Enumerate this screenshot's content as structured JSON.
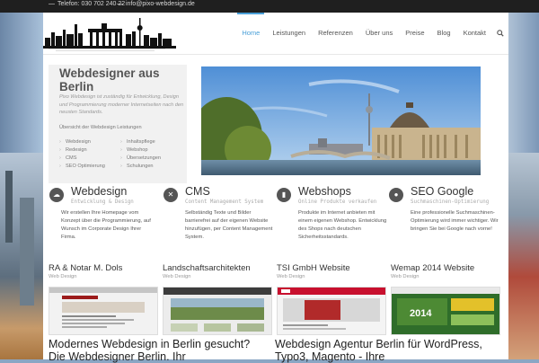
{
  "topbar": {
    "phone": "Telefon: 030 702 240 22",
    "email": "info@pixo-webdesign.de"
  },
  "nav": {
    "items": [
      "Home",
      "Leistungen",
      "Referenzen",
      "Über uns",
      "Preise",
      "Blog",
      "Kontakt"
    ],
    "active": "Home"
  },
  "intro": {
    "title": "Webdesigner aus Berlin",
    "lead": "Pixo Webdesign ist zuständig für Entwicklung, Design und Programmierung moderner Internetseiten nach den neusten Standards.",
    "services_heading": "Übersicht der Webdesign Leistungen",
    "services_left": [
      "Webdesign",
      "Redesign",
      "CMS",
      "SEO Optimierung"
    ],
    "services_right": [
      "Inhaltspflege",
      "Webshop",
      "Übersetzungen",
      "Schulungen"
    ]
  },
  "features": [
    {
      "icon": "cloud-icon",
      "title": "Webdesign",
      "subtitle": "Entwicklung & Design",
      "body": "Wir erstellen Ihre Homepage vom Konzept über die Programmierung, auf Wunsch im Corporate Design Ihrer Firma."
    },
    {
      "icon": "tools-icon",
      "title": "CMS",
      "subtitle": "Content Management System",
      "body": "Selbständig Texte und Bilder barrierefrei auf der eigenen Website hinzufügen, per Content Management System."
    },
    {
      "icon": "cart-icon",
      "title": "Webshops",
      "subtitle": "Online Produkte verkaufen",
      "body": "Produkte im Internet anbieten mit einem eigenen Webshop. Entwicklung des Shops nach deutschen Sicherheitsstandards."
    },
    {
      "icon": "globe-icon",
      "title": "SEO Google",
      "subtitle": "Suchmaschinen-Optimierung",
      "body": "Eine professionelle Suchmaschinen-Optimierung wird immer wichtiger. Wir bringen Sie bei Google nach vorne!"
    }
  ],
  "projects": [
    {
      "title": "RA & Notar M. Dols",
      "category": "Web Design"
    },
    {
      "title": "Landschaftsarchitekten",
      "category": "Web Design"
    },
    {
      "title": "TSI GmbH Website",
      "category": "Web Design"
    },
    {
      "title": "Wemap 2014 Website",
      "category": "Web Design"
    }
  ],
  "bottom": {
    "left": "Modernes Webdesign in Berlin gesucht? Die Webdesigner Berlin. Ihr",
    "right": "Webdesign Agentur Berlin für WordPress, Typo3, Magento - Ihre"
  },
  "thumb_badge": "2014",
  "colors": {
    "accent": "#4aa0d8",
    "text": "#333333",
    "muted": "#999999",
    "icon_bg": "#555555"
  }
}
